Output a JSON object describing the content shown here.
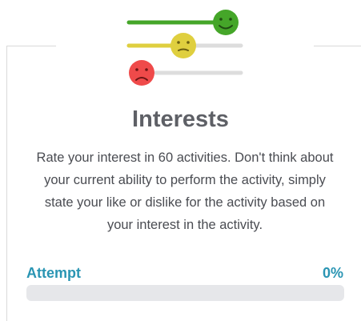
{
  "card": {
    "title": "Interests",
    "description": "Rate your interest in 60 activities. Don't think about your current ability to perform the activity, simply state your like or dislike for the activity based on your interest in the activity."
  },
  "rating_graphic": {
    "rows": [
      {
        "icon": "happy-face-icon",
        "color": "#45a629",
        "level": 1.0
      },
      {
        "icon": "neutral-face-icon",
        "color": "#dfcf3f",
        "level": 0.5
      },
      {
        "icon": "sad-face-icon",
        "color": "#ef4a4a",
        "level": 0.0
      }
    ],
    "track_color": "#dddddd"
  },
  "progress": {
    "label": "Attempt",
    "value_text": "0%",
    "value": 0
  },
  "colors": {
    "accent": "#2a95b3",
    "title": "#5e6066",
    "text": "#4a4c52",
    "track": "#e6e7ea"
  }
}
